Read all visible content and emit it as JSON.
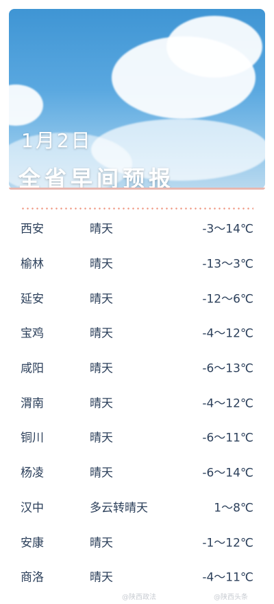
{
  "banner": {
    "date": "1月2日",
    "title": "全省早间预报"
  },
  "forecast": [
    {
      "city": "西安",
      "weather": "晴天",
      "temp": "-3～14℃"
    },
    {
      "city": "榆林",
      "weather": "晴天",
      "temp": "-13～3℃"
    },
    {
      "city": "延安",
      "weather": "晴天",
      "temp": "-12～6℃"
    },
    {
      "city": "宝鸡",
      "weather": "晴天",
      "temp": "-4～12℃"
    },
    {
      "city": "咸阳",
      "weather": "晴天",
      "temp": "-6～13℃"
    },
    {
      "city": "渭南",
      "weather": "晴天",
      "temp": "-4～12℃"
    },
    {
      "city": "铜川",
      "weather": "晴天",
      "temp": "-6～11℃"
    },
    {
      "city": "杨凌",
      "weather": "晴天",
      "temp": "-6～14℃"
    },
    {
      "city": "汉中",
      "weather": "多云转晴天",
      "temp": "1～8℃"
    },
    {
      "city": "安康",
      "weather": "晴天",
      "temp": "-1～12℃"
    },
    {
      "city": "商洛",
      "weather": "晴天",
      "temp": "-4～11℃"
    }
  ],
  "watermarks": [
    "@陕西政法",
    "@陕西头条"
  ],
  "colors": {
    "sky": "#3f95d4",
    "text": "#2b3f5a",
    "dot_divider": "#ef9a86"
  }
}
